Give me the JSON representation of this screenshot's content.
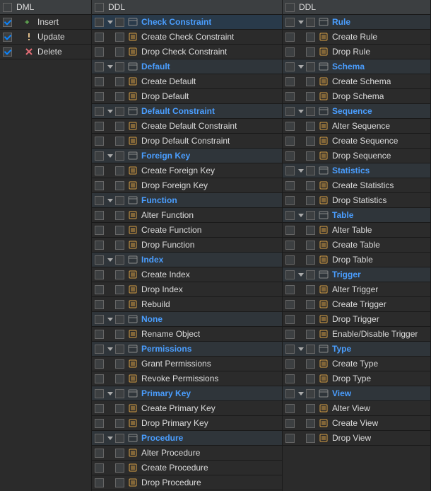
{
  "dml": {
    "header": "DML",
    "items": [
      {
        "label": "Insert",
        "checked": true,
        "icon": "plus-icon"
      },
      {
        "label": "Update",
        "checked": true,
        "icon": "warn-icon"
      },
      {
        "label": "Delete",
        "checked": true,
        "icon": "cross-icon"
      }
    ]
  },
  "ddl1": {
    "header": "DDL",
    "categories": [
      {
        "label": "Check Constraint",
        "highlight": true,
        "items": [
          {
            "label": "Create Check Constraint"
          },
          {
            "label": "Drop Check Constraint"
          }
        ]
      },
      {
        "label": "Default",
        "items": [
          {
            "label": "Create Default"
          },
          {
            "label": "Drop Default"
          }
        ]
      },
      {
        "label": "Default Constraint",
        "items": [
          {
            "label": "Create Default Constraint"
          },
          {
            "label": "Drop Default Constraint"
          }
        ]
      },
      {
        "label": "Foreign Key",
        "items": [
          {
            "label": "Create Foreign Key"
          },
          {
            "label": "Drop Foreign Key"
          }
        ]
      },
      {
        "label": "Function",
        "items": [
          {
            "label": "Alter Function"
          },
          {
            "label": "Create Function"
          },
          {
            "label": "Drop Function"
          }
        ]
      },
      {
        "label": "Index",
        "items": [
          {
            "label": "Create Index"
          },
          {
            "label": "Drop Index"
          },
          {
            "label": "Rebuild"
          }
        ]
      },
      {
        "label": "None",
        "items": [
          {
            "label": "Rename Object"
          }
        ]
      },
      {
        "label": "Permissions",
        "items": [
          {
            "label": "Grant Permissions"
          },
          {
            "label": "Revoke Permissions"
          }
        ]
      },
      {
        "label": "Primary Key",
        "items": [
          {
            "label": "Create Primary Key"
          },
          {
            "label": "Drop Primary Key"
          }
        ]
      },
      {
        "label": "Procedure",
        "items": [
          {
            "label": "Alter Procedure"
          },
          {
            "label": "Create Procedure"
          },
          {
            "label": "Drop Procedure"
          }
        ]
      }
    ]
  },
  "ddl2": {
    "header": "DDL",
    "categories": [
      {
        "label": "Rule",
        "items": [
          {
            "label": "Create Rule"
          },
          {
            "label": "Drop Rule"
          }
        ]
      },
      {
        "label": "Schema",
        "items": [
          {
            "label": "Create Schema"
          },
          {
            "label": "Drop Schema"
          }
        ]
      },
      {
        "label": "Sequence",
        "items": [
          {
            "label": "Alter Sequence"
          },
          {
            "label": "Create Sequence"
          },
          {
            "label": "Drop Sequence"
          }
        ]
      },
      {
        "label": "Statistics",
        "items": [
          {
            "label": "Create Statistics"
          },
          {
            "label": "Drop Statistics"
          }
        ]
      },
      {
        "label": "Table",
        "items": [
          {
            "label": "Alter Table"
          },
          {
            "label": "Create Table"
          },
          {
            "label": "Drop Table"
          }
        ]
      },
      {
        "label": "Trigger",
        "items": [
          {
            "label": "Alter Trigger"
          },
          {
            "label": "Create Trigger"
          },
          {
            "label": "Drop Trigger"
          },
          {
            "label": "Enable/Disable Trigger"
          }
        ]
      },
      {
        "label": "Type",
        "items": [
          {
            "label": "Create Type"
          },
          {
            "label": "Drop Type"
          }
        ]
      },
      {
        "label": "View",
        "items": [
          {
            "label": "Alter View"
          },
          {
            "label": "Create View"
          },
          {
            "label": "Drop View"
          }
        ]
      }
    ]
  }
}
